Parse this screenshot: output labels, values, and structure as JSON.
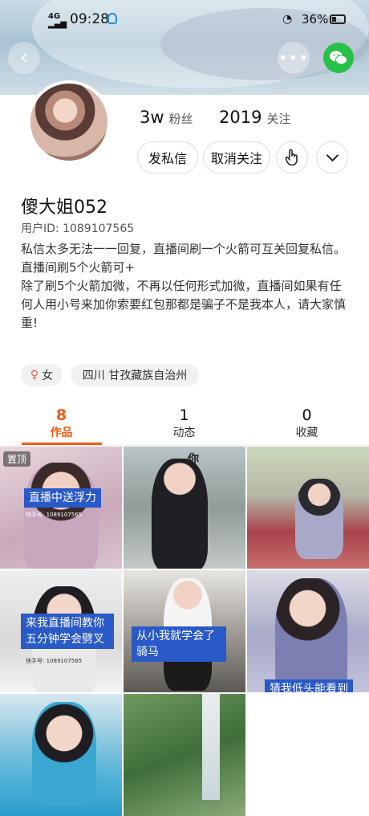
{
  "status_bar": {
    "network": "4G HD",
    "time": "09:28",
    "battery": "36%"
  },
  "profile": {
    "fans_count": "3w",
    "fans_label": "粉丝",
    "following_count": "2019",
    "following_label": "关注",
    "message_button": "发私信",
    "unfollow_button": "取消关注",
    "name": "傻大姐052",
    "user_id": "用户ID: 1089107565",
    "bio": [
      "私信太多无法一一回复，直播间刷一个火箭可互关回复私信。",
      "直播间刷5个火箭可+",
      "除了刷5个火箭加微，不再以任何形式加微，直播间如果有任何人用小号来加你索要红包那都是骗子不是我本人，请大家慎重!"
    ],
    "gender": "女",
    "location": "四川 甘孜藏族自治州"
  },
  "tabs": [
    {
      "count": "8",
      "label": "作品"
    },
    {
      "count": "1",
      "label": "动态"
    },
    {
      "count": "0",
      "label": "收藏"
    }
  ],
  "videos": [
    {
      "pinned": "置顶",
      "caption": "直播中送浮力",
      "watermark": "快手号: 1089107565"
    },
    {
      "caption": "你"
    },
    {
      "caption": ""
    },
    {
      "caption": "来我直播间教你 五分钟学会劈叉",
      "watermark": "快手号: 1089107565"
    },
    {
      "caption": "从小我就学会了 骑马"
    },
    {
      "caption": "猜我低头能看到"
    },
    {
      "caption": ""
    },
    {
      "caption": ""
    }
  ],
  "colors": {
    "accent": "#f05a14",
    "wechat": "#27c14a",
    "caption_bg": "#2a59c8"
  }
}
